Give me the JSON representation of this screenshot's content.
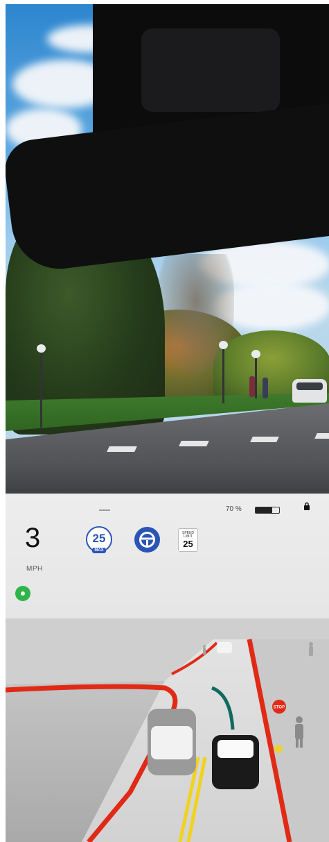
{
  "display": {
    "speed": "3",
    "speed_unit": "MPH",
    "battery_percent": "70 %",
    "battery_level": 0.7,
    "set_speed_max": "25",
    "set_speed_label": "MAX",
    "speed_limit_label": "SPEED LIMIT",
    "speed_limit_value": "25",
    "stop_sign_text": "STOP",
    "icons": [
      "lock-icon",
      "steering-wheel-icon",
      "autopilot-ready-icon"
    ],
    "colors": {
      "autopilot_blue": "#2a55b5",
      "autopilot_green": "#2fb34a",
      "lane_red": "#e02a16",
      "lane_yellow": "#f1d21e",
      "path_teal": "#0e6b5e"
    }
  }
}
